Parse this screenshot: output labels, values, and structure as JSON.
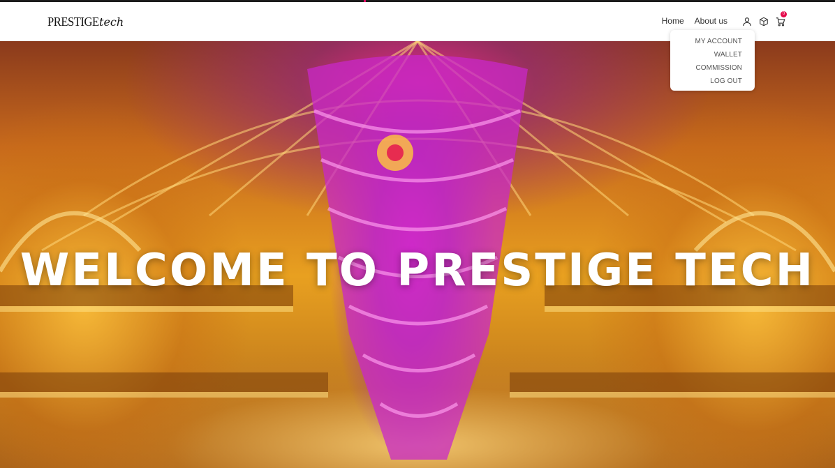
{
  "brand": {
    "logo_main": "PRESTIGE",
    "logo_script": "tech"
  },
  "nav": {
    "links": [
      {
        "label": "Home"
      },
      {
        "label": "About us"
      }
    ]
  },
  "icons": {
    "user": "user-icon",
    "package": "package-icon",
    "cart": "cart-icon"
  },
  "cart": {
    "count": "0"
  },
  "account_menu": {
    "items": [
      {
        "label": "MY ACCOUNT"
      },
      {
        "label": "WALLET"
      },
      {
        "label": "COMMISSION"
      },
      {
        "label": "LOG OUT"
      }
    ]
  },
  "hero": {
    "title": "WELCOME TO PRESTIGE TECH"
  },
  "colors": {
    "accent": "#e5094a",
    "nav_bg": "#ffffff",
    "hero_text": "#ffffff"
  }
}
